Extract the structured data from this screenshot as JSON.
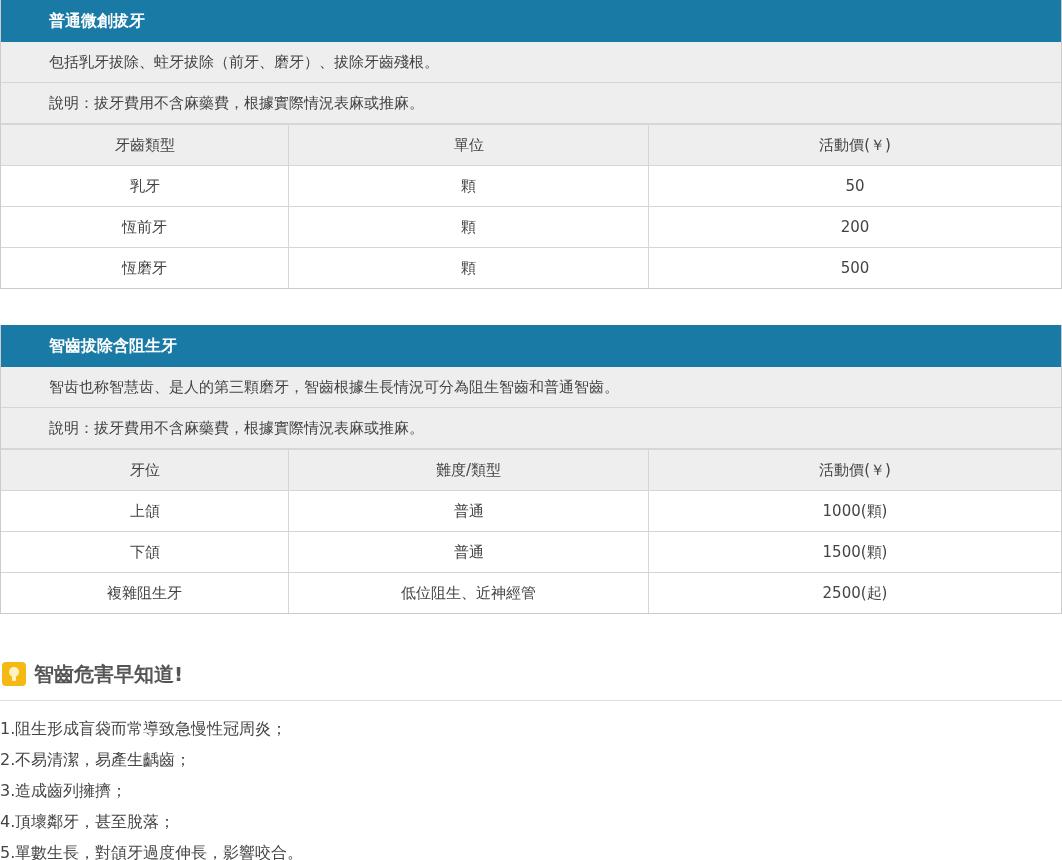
{
  "sections": [
    {
      "title": "普通微創拔牙",
      "notes": [
        "包括乳牙拔除、蛀牙拔除（前牙、磨牙）、拔除牙齒殘根。",
        "說明：拔牙費用不含麻藥費，根據實際情況表麻或推麻。"
      ],
      "table": {
        "columns": [
          "牙齒類型",
          "單位",
          "活動價(￥)"
        ],
        "rows": [
          [
            "乳牙",
            "顆",
            "50"
          ],
          [
            "恆前牙",
            "顆",
            "200"
          ],
          [
            "恆磨牙",
            "顆",
            "500"
          ]
        ]
      }
    },
    {
      "title": "智齒拔除含阻生牙",
      "notes": [
        "智齿也称智慧齿、是人的第三顆磨牙，智齒根據生長情況可分為阻生智齒和普通智齒。",
        "說明：拔牙費用不含麻藥費，根據實際情況表麻或推麻。"
      ],
      "table": {
        "columns": [
          "牙位",
          "難度/類型",
          "活動價(￥)"
        ],
        "rows": [
          [
            "上頜",
            "普通",
            "1000(顆)"
          ],
          [
            "下頜",
            "普通",
            "1500(顆)"
          ],
          [
            "複雜阻生牙",
            "低位阻生、近神經管",
            "2500(起)"
          ]
        ]
      }
    }
  ],
  "tips": {
    "heading": "智齒危害早知道!",
    "items": [
      "1.阻生形成盲袋而常導致急慢性冠周炎；",
      "2.不易清潔，易產生齲齒；",
      "3.造成齒列擁擠；",
      "4.頂壞鄰牙，甚至脫落；",
      "5.單數生長，對頜牙過度伸長，影響咬合。"
    ]
  }
}
